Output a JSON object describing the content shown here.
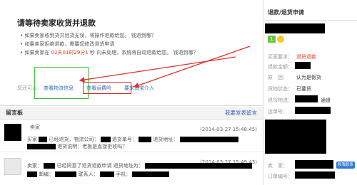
{
  "main": {
    "title": "请等待卖家收货并退款",
    "notes": [
      {
        "prefix": "• 如果卖家收到货并验货无误，将操作退款给您。 钱退到哪？",
        "hl": "",
        "suffix": ""
      },
      {
        "prefix": "• 如果卖家拒绝退款，需要您修改退货申请",
        "hl": "",
        "suffix": ""
      },
      {
        "prefix": "• 如果卖家在 ",
        "hl": "02天01时29分1",
        "suffix": " 秒 内未处理，系统将自动退款给您。 钱退到哪？"
      }
    ],
    "action_prompt": "您还可以:",
    "actions": {
      "view_logistics": "查看物流信息",
      "view_shipping_fee": "查看运费险",
      "request_arbitration": "要求淘宝介入"
    }
  },
  "messages": {
    "title": "留言板",
    "post_link": "我要发表留言",
    "items": [
      {
        "role_top": "卖家",
        "role_side": "买家",
        "time": "(2014-03-27 15:48:45)",
        "line1_a": "已经退货，物流公司：",
        "line1_b": "退货单号：",
        "line1_c": "退货地址：",
        "line2": "退货说明：老板是直接拒收吗？"
      },
      {
        "role": "卖家：",
        "time": "(2014-03-27 15:49:43)",
        "line1": "已经同意了退货退款申请 退货地址为：",
        "line2_a": "邮编：",
        "line2_b": "联系人：",
        "line2_c": "手机："
      }
    ]
  },
  "sidebar": {
    "title": "退款/退货申请",
    "badge_text": "1",
    "fields": [
      {
        "label": "买家要求：",
        "value": "退货退款"
      },
      {
        "label": "退款金额：",
        "value": ""
      },
      {
        "label": "原　因：",
        "value": "认为是假货"
      },
      {
        "label": "货物状态：",
        "value": "已要货"
      },
      {
        "label": "退货物流：",
        "value": "通道"
      },
      {
        "label": "运单号：",
        "value": ""
      },
      {
        "label": "卖　家：",
        "value": ""
      },
      {
        "label": "订单编号：",
        "value": ""
      }
    ],
    "button_label": "和我联系"
  }
}
